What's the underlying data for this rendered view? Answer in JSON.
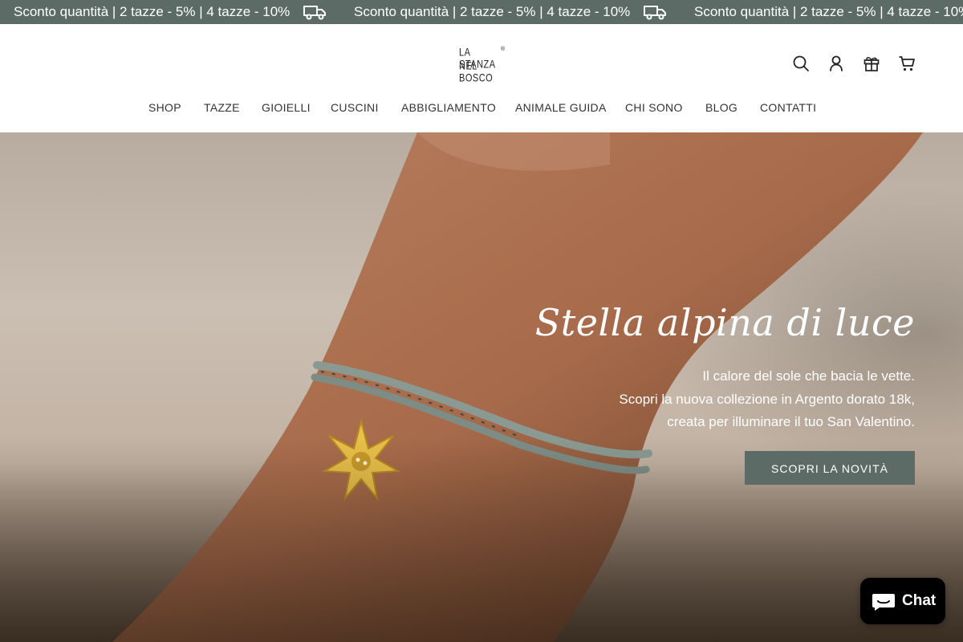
{
  "announcement": {
    "items": [
      "Sconto quantità | 2 tazze - 5% | 4 tazze - 10%",
      "Sconto quantità | 2 tazze - 5% | 4 tazze - 10%",
      "Sconto quantità | 2 tazze - 5% | 4 tazze - 10%"
    ],
    "icon": "truck-icon"
  },
  "brand": {
    "logo_line1": "LA STANZA",
    "logo_line2": "NEL BOSCO",
    "logo_mark": "®"
  },
  "header_icons": [
    "search-icon",
    "account-icon",
    "gift-icon",
    "cart-icon"
  ],
  "nav": {
    "items": [
      "SHOP",
      "TAZZE",
      "GIOIELLI",
      "CUSCINI",
      "ABBIGLIAMENTO",
      "ANIMALE GUIDA",
      "CHI SONO",
      "BLOG",
      "CONTATTI"
    ]
  },
  "hero": {
    "title": "Stella alpina di luce",
    "lines": [
      "Il calore del sole che bacia le vette.",
      "Scopri la nuova collezione in Argento dorato 18k,",
      "creata per illuminare il tuo San Valentino."
    ],
    "cta_label": "SCOPRI LA NOVITÀ"
  },
  "chat": {
    "label": "Chat",
    "icon": "chat-bubble-icon"
  },
  "colors": {
    "accent": "#5c6b66",
    "chat_bg": "#000000"
  }
}
